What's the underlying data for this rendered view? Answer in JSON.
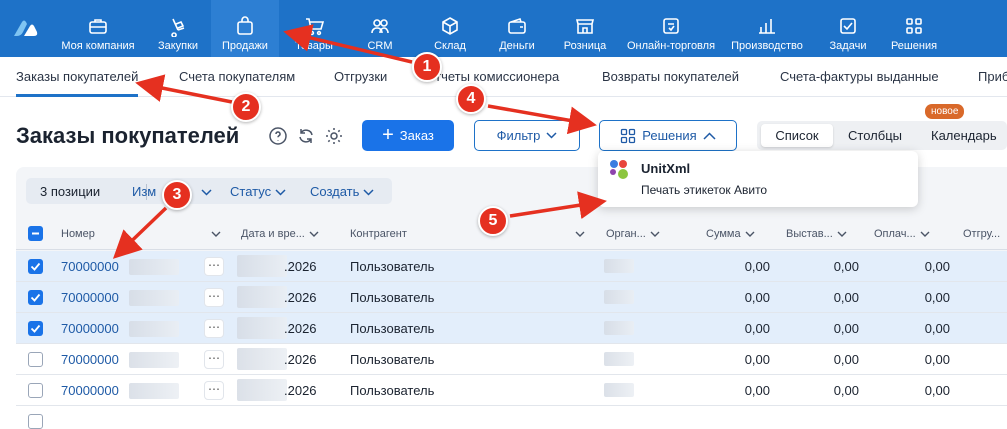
{
  "nav": {
    "items": [
      {
        "label": "Моя компания",
        "icon": "briefcase-icon"
      },
      {
        "label": "Закупки",
        "icon": "cart-dolly-icon"
      },
      {
        "label": "Продажи",
        "icon": "shopping-bag-icon",
        "active": true
      },
      {
        "label": "Товары",
        "icon": "cart-icon"
      },
      {
        "label": "CRM",
        "icon": "people-icon"
      },
      {
        "label": "Склад",
        "icon": "box-icon"
      },
      {
        "label": "Деньги",
        "icon": "wallet-icon"
      },
      {
        "label": "Розница",
        "icon": "store-icon"
      },
      {
        "label": "Онлайн-торговля",
        "icon": "online-store-icon"
      },
      {
        "label": "Производство",
        "icon": "bar-chart-icon"
      },
      {
        "label": "Задачи",
        "icon": "checklist-icon"
      },
      {
        "label": "Решения",
        "icon": "grid-apps-icon"
      }
    ],
    "accent": "#1e72c8"
  },
  "subnav": {
    "items": [
      "Заказы покупателей",
      "Счета покупателям",
      "Отгрузки",
      "Отчеты комиссионера",
      "Возвраты покупателей",
      "Счета-фактуры выданные",
      "Приб"
    ]
  },
  "header": {
    "title": "Заказы покупателей",
    "order_button": "Заказ",
    "filter_button": "Фильтр",
    "solutions_button": "Решения",
    "views": [
      "Список",
      "Столбцы",
      "Календарь"
    ],
    "new_badge": "новое"
  },
  "popup": {
    "title": "UnitXml",
    "item": "Печать этикеток Авито"
  },
  "actionbar": {
    "count": "3 позиции",
    "change": "Изм",
    "status": "Статус",
    "create": "Создать"
  },
  "table": {
    "columns": [
      "Номер",
      "Дата и вре...",
      "Контрагент",
      "Орган...",
      "Сумма",
      "Выстав...",
      "Оплач...",
      "Отгру..."
    ],
    "rows": [
      {
        "number": "70000000",
        "date": ".2026",
        "counterparty": "Пользователь",
        "sum": "0,00",
        "issued": "0,00",
        "paid": "0,00",
        "selected": true
      },
      {
        "number": "70000000",
        "date": ".2026",
        "counterparty": "Пользователь",
        "sum": "0,00",
        "issued": "0,00",
        "paid": "0,00",
        "selected": true
      },
      {
        "number": "70000000",
        "date": ".2026",
        "counterparty": "Пользователь",
        "sum": "0,00",
        "issued": "0,00",
        "paid": "0,00",
        "selected": true
      },
      {
        "number": "70000000",
        "date": ".2026",
        "counterparty": "Пользователь",
        "sum": "0,00",
        "issued": "0,00",
        "paid": "0,00",
        "selected": false
      },
      {
        "number": "70000000",
        "date": ".2026",
        "counterparty": "Пользователь",
        "sum": "0,00",
        "issued": "0,00",
        "paid": "0,00",
        "selected": false
      }
    ]
  },
  "annotations": [
    "1",
    "2",
    "3",
    "4",
    "5"
  ],
  "annotation_color": "#e53020"
}
